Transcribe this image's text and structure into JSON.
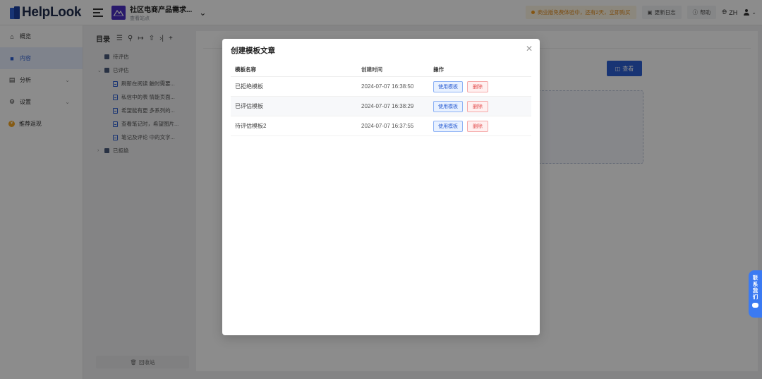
{
  "topbar": {
    "logo_text": "HelpLook",
    "project_title": "社区电商产品需求...",
    "project_sub": "查看站点",
    "notice": "商业版免费体验中，还有2天，立即购买",
    "changelog": "更新日志",
    "help": "帮助",
    "lang": "ZH"
  },
  "leftnav": {
    "items": [
      {
        "label": "概览",
        "icon": "home-icon"
      },
      {
        "label": "内容",
        "icon": "content-icon"
      },
      {
        "label": "分析",
        "icon": "analytics-icon"
      },
      {
        "label": "设置",
        "icon": "gear-icon"
      },
      {
        "label": "推荐返现",
        "icon": "coin-icon"
      }
    ]
  },
  "tree": {
    "title": "目录",
    "items": [
      {
        "label": "待评估"
      },
      {
        "label": "已评估"
      },
      {
        "label": "刷新在阅读 触时需要..."
      },
      {
        "label": "私信中的表 情能页面..."
      },
      {
        "label": "希望能有更 多系列的..."
      },
      {
        "label": "查看笔记时，希望图片..."
      },
      {
        "label": "笔记及评论 中的文字..."
      },
      {
        "label": "已拒绝"
      }
    ],
    "recycle": "回收站"
  },
  "content": {
    "view_label": "查看"
  },
  "modal": {
    "title": "创建模板文章",
    "headers": {
      "name": "模板名称",
      "time": "创建时间",
      "ops": "操作"
    },
    "rows": [
      {
        "name": "已拒绝模板",
        "time": "2024-07-07 16:38:50",
        "use": "使用模板",
        "del": "删除"
      },
      {
        "name": "已评估模板",
        "time": "2024-07-07 16:38:29",
        "use": "使用模板",
        "del": "删除"
      },
      {
        "name": "待评估模板2",
        "time": "2024-07-07 16:37:55",
        "use": "使用模板",
        "del": "删除"
      }
    ]
  },
  "contact": {
    "label": "联系我们"
  },
  "colors": {
    "accent": "#2d5fd3",
    "danger": "#e34d4d",
    "warning": "#e08a1e"
  }
}
